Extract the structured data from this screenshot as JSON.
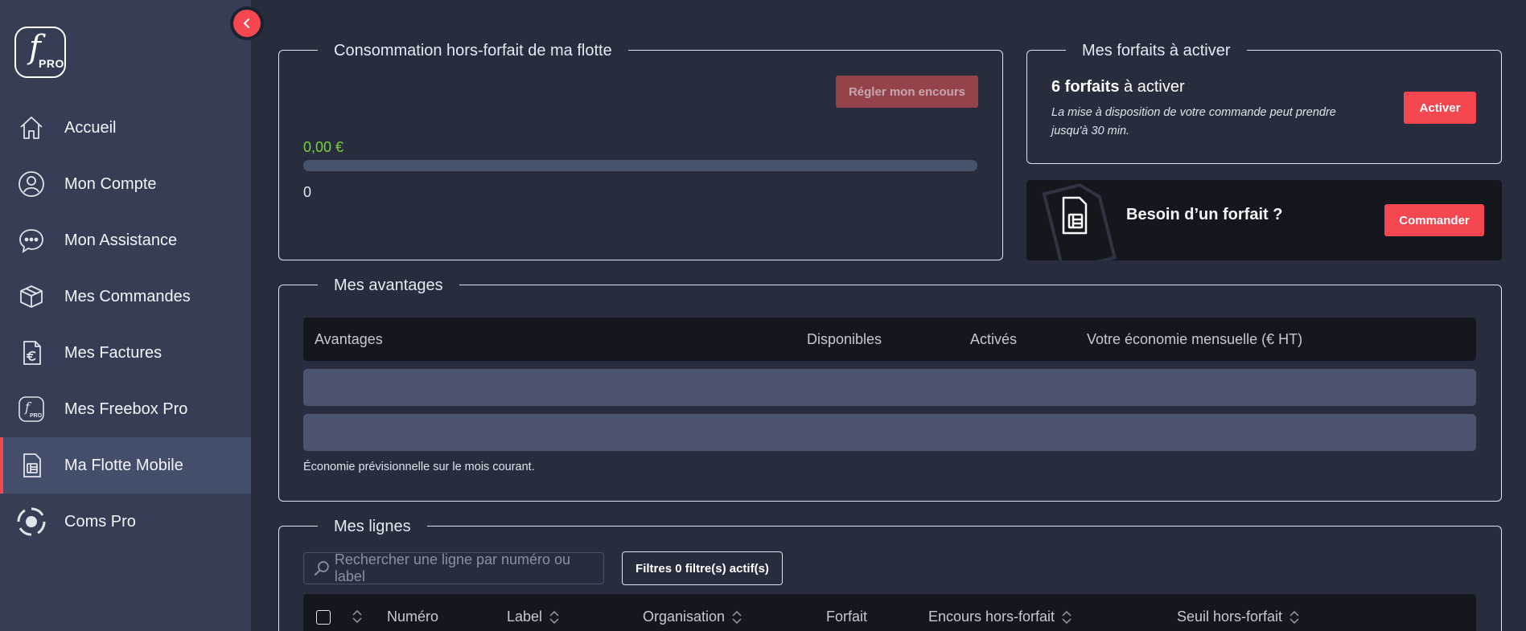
{
  "logo": {
    "letter": "f",
    "sub": "PRO"
  },
  "sidebar": {
    "items": [
      {
        "label": "Accueil",
        "icon": "home-icon"
      },
      {
        "label": "Mon Compte",
        "icon": "user-icon"
      },
      {
        "label": "Mon Assistance",
        "icon": "chat-icon"
      },
      {
        "label": "Mes Commandes",
        "icon": "box-icon"
      },
      {
        "label": "Mes Factures",
        "icon": "invoice-euro-icon"
      },
      {
        "label": "Mes Freebox Pro",
        "icon": "freebox-pro-icon"
      },
      {
        "label": "Ma Flotte Mobile",
        "icon": "sim-card-icon",
        "active": true
      },
      {
        "label": "Coms Pro",
        "icon": "coms-pro-icon"
      }
    ]
  },
  "consumption": {
    "title": "Consommation hors-forfait de ma flotte",
    "button": "Régler mon encours",
    "amount": "0,00 €",
    "count": "0",
    "progress": 0
  },
  "forfaits": {
    "title": "Mes forfaits à activer",
    "count_bold": "6 forfaits",
    "count_rest": " à activer",
    "note": "La mise à disposition de votre commande peut prendre jusqu'à 30 min.",
    "button": "Activer"
  },
  "need_forfait": {
    "text": "Besoin d’un forfait ?",
    "button": "Commander"
  },
  "advantages": {
    "title": "Mes avantages",
    "columns": [
      "Avantages",
      "Disponibles",
      "Activés",
      "Votre économie mensuelle (€ HT)"
    ],
    "footnote": "Économie prévisionnelle sur le mois courant."
  },
  "lines": {
    "title": "Mes lignes",
    "search_placeholder": "Rechercher une ligne par numéro ou label",
    "filter_label": "Filtres",
    "filter_count": "0 filtre(s) actif(s)",
    "columns": [
      "Numéro",
      "Label",
      "Organisation",
      "Forfait",
      "Encours hors-forfait",
      "Seuil hors-forfait"
    ]
  },
  "colors": {
    "accent": "#f4474f",
    "success": "#7ccf3c",
    "sidebar": "#353e55",
    "background": "#272d3d"
  }
}
